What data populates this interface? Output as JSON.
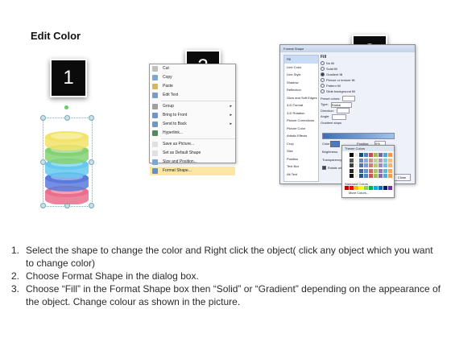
{
  "title": "Edit Color",
  "steps": {
    "one": "1",
    "two": "2",
    "three": "3"
  },
  "shape": {
    "discs": [
      "#f3e36a",
      "#84d274",
      "#65c9f0",
      "#5b7bdc",
      "#ea6f8d"
    ]
  },
  "menu": {
    "items": [
      {
        "label": "Cut",
        "color": "#c0c0c0"
      },
      {
        "label": "Copy",
        "color": "#7aa6d8"
      },
      {
        "label": "Paste",
        "color": "#d8b560"
      },
      {
        "label": "Edit Text",
        "color": "#7a9bd0"
      },
      {
        "label": "Group",
        "color": "#a0a0a0",
        "submenu": true
      },
      {
        "label": "Bring to Front",
        "color": "#6f96c9",
        "submenu": true
      },
      {
        "label": "Send to Back",
        "color": "#6f96c9",
        "submenu": true
      },
      {
        "label": "Hyperlink...",
        "color": "#4d8c54"
      },
      {
        "label": "Save as Picture...",
        "color": "#e0e0e0"
      },
      {
        "label": "Set as Default Shape",
        "color": "#e0e0e0"
      },
      {
        "label": "Size and Position...",
        "color": "#7aa6d8"
      },
      {
        "label": "Format Shape...",
        "color": "#5f8fd0",
        "highlighted": true
      }
    ]
  },
  "dialog": {
    "title": "Format Shape",
    "categories": [
      "Fill",
      "Line Color",
      "Line Style",
      "Shadow",
      "Reflection",
      "Glow and Soft Edges",
      "3-D Format",
      "3-D Rotation",
      "Picture Corrections",
      "Picture Color",
      "Artistic Effects",
      "Crop",
      "Size",
      "Position",
      "Text Box",
      "Alt Text"
    ],
    "fill_heading": "Fill",
    "fill_options": [
      "No fill",
      "Solid fill",
      "Gradient fill",
      "Picture or texture fill",
      "Pattern fill",
      "Slide background fill"
    ],
    "preset_colors": "Preset colors:",
    "type": "Type:",
    "type_value": "Radial",
    "direction": "Direction:",
    "angle": "Angle:",
    "gradient_stops": "Gradient stops",
    "color": "Color",
    "position": "Position:",
    "position_value": "0%",
    "brightness": "Brightness:",
    "transparency": "Transparency:",
    "rotate": "Rotate with shape",
    "close": "Close"
  },
  "palette": {
    "theme_colors": "Theme Colors",
    "standard_colors": "Standard Colors",
    "more_colors": "More Colors..."
  },
  "instructions": [
    {
      "num": "1.",
      "text": "Select the shape to change the color and Right click the object( click any object which you want to change color)"
    },
    {
      "num": "2.",
      "text": "Choose Format Shape in the dialog box."
    },
    {
      "num": "3.",
      "text": "Choose “Fill” in the Format Shape box then “Solid” or “Gradient” depending on the appearance of the object. Change colour as shown in the picture."
    }
  ]
}
